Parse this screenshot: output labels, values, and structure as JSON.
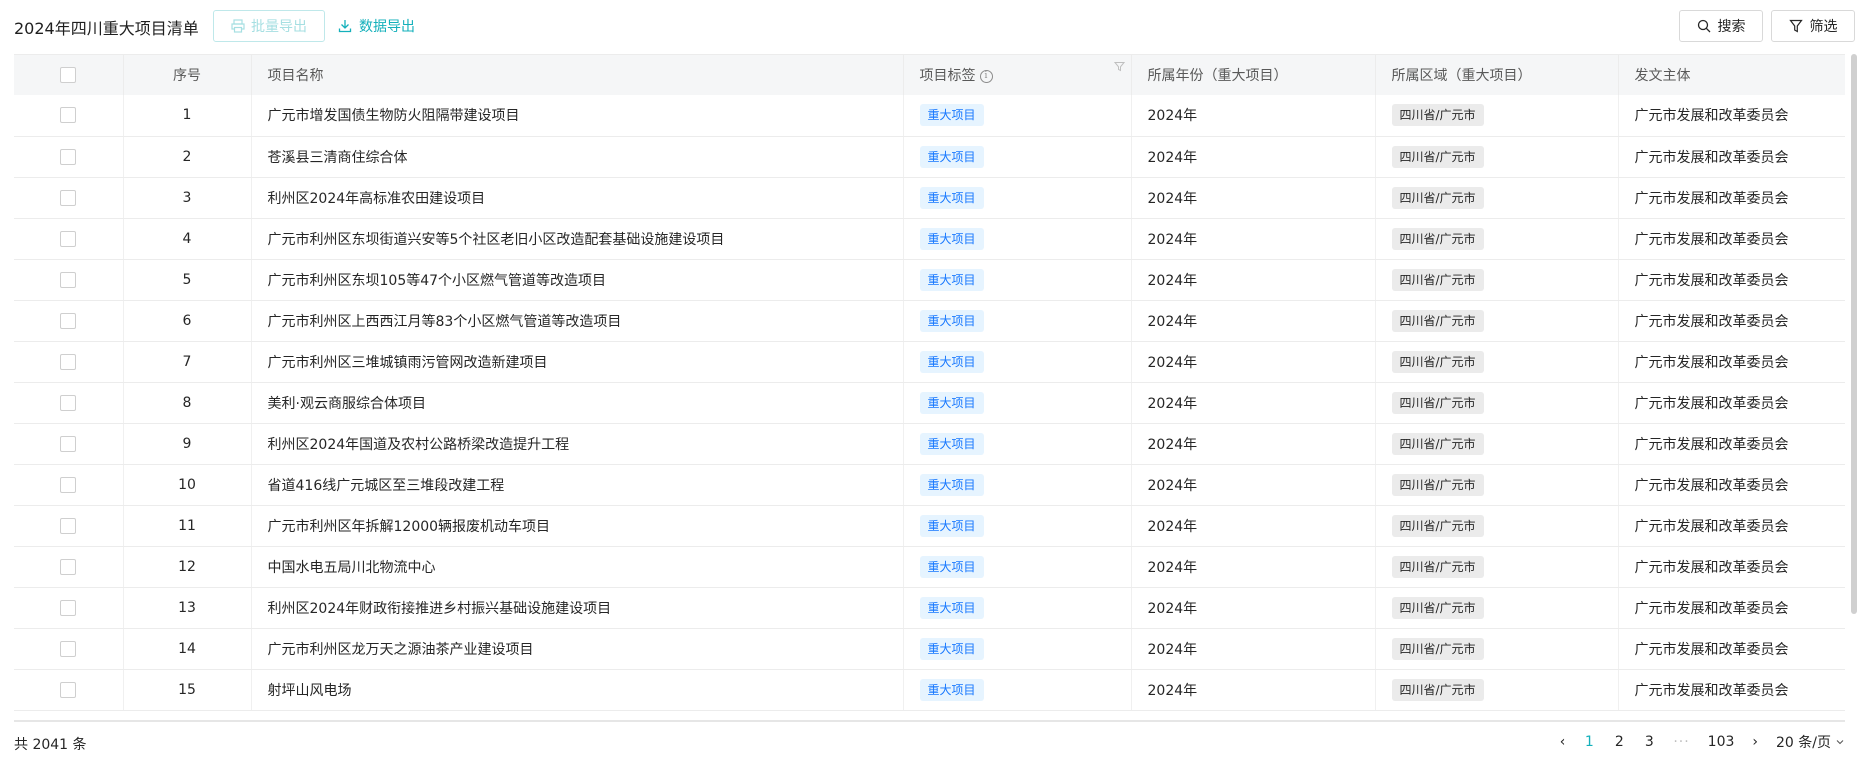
{
  "header": {
    "title": "2024年四川重大项目清单",
    "batch_export": "批量导出",
    "data_export": "数据导出",
    "search": "搜索",
    "filter": "筛选"
  },
  "table": {
    "columns": [
      "序号",
      "项目名称",
      "项目标签",
      "所属年份（重大项目）",
      "所属区域（重大项目）",
      "发文主体"
    ],
    "rows": [
      {
        "idx": "1",
        "name": "广元市增发国债生物防火阻隔带建设项目",
        "tag": "重大项目",
        "year": "2024年",
        "region": "四川省/广元市",
        "issuer": "广元市发展和改革委员会"
      },
      {
        "idx": "2",
        "name": "苍溪县三清商住综合体",
        "tag": "重大项目",
        "year": "2024年",
        "region": "四川省/广元市",
        "issuer": "广元市发展和改革委员会"
      },
      {
        "idx": "3",
        "name": "利州区2024年高标准农田建设项目",
        "tag": "重大项目",
        "year": "2024年",
        "region": "四川省/广元市",
        "issuer": "广元市发展和改革委员会"
      },
      {
        "idx": "4",
        "name": "广元市利州区东坝街道兴安等5个社区老旧小区改造配套基础设施建设项目",
        "tag": "重大项目",
        "year": "2024年",
        "region": "四川省/广元市",
        "issuer": "广元市发展和改革委员会"
      },
      {
        "idx": "5",
        "name": "广元市利州区东坝105等47个小区燃气管道等改造项目",
        "tag": "重大项目",
        "year": "2024年",
        "region": "四川省/广元市",
        "issuer": "广元市发展和改革委员会"
      },
      {
        "idx": "6",
        "name": "广元市利州区上西西江月等83个小区燃气管道等改造项目",
        "tag": "重大项目",
        "year": "2024年",
        "region": "四川省/广元市",
        "issuer": "广元市发展和改革委员会"
      },
      {
        "idx": "7",
        "name": "广元市利州区三堆城镇雨污管网改造新建项目",
        "tag": "重大项目",
        "year": "2024年",
        "region": "四川省/广元市",
        "issuer": "广元市发展和改革委员会"
      },
      {
        "idx": "8",
        "name": "美利·观云商服综合体项目",
        "tag": "重大项目",
        "year": "2024年",
        "region": "四川省/广元市",
        "issuer": "广元市发展和改革委员会"
      },
      {
        "idx": "9",
        "name": "利州区2024年国道及农村公路桥梁改造提升工程",
        "tag": "重大项目",
        "year": "2024年",
        "region": "四川省/广元市",
        "issuer": "广元市发展和改革委员会"
      },
      {
        "idx": "10",
        "name": "省道416线广元城区至三堆段改建工程",
        "tag": "重大项目",
        "year": "2024年",
        "region": "四川省/广元市",
        "issuer": "广元市发展和改革委员会"
      },
      {
        "idx": "11",
        "name": "广元市利州区年拆解12000辆报废机动车项目",
        "tag": "重大项目",
        "year": "2024年",
        "region": "四川省/广元市",
        "issuer": "广元市发展和改革委员会"
      },
      {
        "idx": "12",
        "name": "中国水电五局川北物流中心",
        "tag": "重大项目",
        "year": "2024年",
        "region": "四川省/广元市",
        "issuer": "广元市发展和改革委员会"
      },
      {
        "idx": "13",
        "name": "利州区2024年财政衔接推进乡村振兴基础设施建设项目",
        "tag": "重大项目",
        "year": "2024年",
        "region": "四川省/广元市",
        "issuer": "广元市发展和改革委员会"
      },
      {
        "idx": "14",
        "name": "广元市利州区龙万天之源油茶产业建设项目",
        "tag": "重大项目",
        "year": "2024年",
        "region": "四川省/广元市",
        "issuer": "广元市发展和改革委员会"
      },
      {
        "idx": "15",
        "name": "射坪山风电场",
        "tag": "重大项目",
        "year": "2024年",
        "region": "四川省/广元市",
        "issuer": "广元市发展和改革委员会"
      }
    ]
  },
  "footer": {
    "total": "共 2041 条",
    "pages": [
      "1",
      "2",
      "3"
    ],
    "ellipsis": "···",
    "last_page": "103",
    "page_size": "20 条/页"
  },
  "colors": {
    "accent": "#14b0bb",
    "tag_blue_bg": "#e6f4ff",
    "tag_blue_text": "#1677ff",
    "tag_gray_bg": "#ebebeb"
  }
}
